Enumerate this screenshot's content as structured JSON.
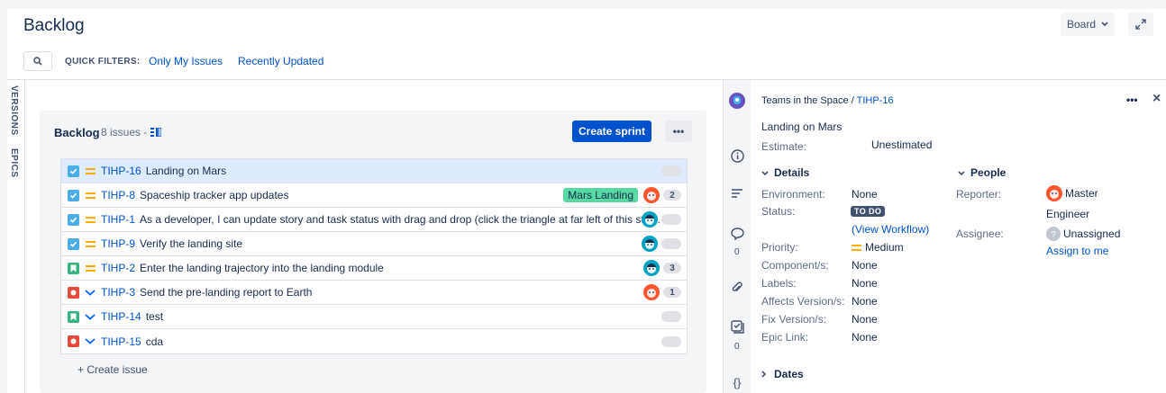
{
  "header": {
    "title": "Backlog",
    "board_label": "Board",
    "quick_filters_label": "QUICK FILTERS:",
    "quick_filters": [
      "Only My Issues",
      "Recently Updated"
    ]
  },
  "side_tabs": [
    "VERSIONS",
    "EPICS"
  ],
  "backlog": {
    "title": "Backlog",
    "count": "8 issues -",
    "create_sprint": "Create sprint",
    "more": "•••",
    "create_issue": "+ Create issue",
    "issues": [
      {
        "type": "task",
        "priority": "medium",
        "key": "TIHP-16",
        "summary": "Landing on Mars",
        "epic": "",
        "avatar": "",
        "count": "",
        "selected": true
      },
      {
        "type": "task",
        "priority": "medium",
        "key": "TIHP-8",
        "summary": "Spaceship tracker app updates",
        "epic": "Mars Landing",
        "avatar": "orange",
        "count": "2",
        "selected": false
      },
      {
        "type": "task",
        "priority": "medium",
        "key": "TIHP-1",
        "summary": "As a developer, I can update story and task status with drag and drop (click the triangle at far left of this sto…",
        "epic": "",
        "avatar": "teal",
        "count": "",
        "selected": false
      },
      {
        "type": "task",
        "priority": "medium",
        "key": "TIHP-9",
        "summary": "Verify the landing site",
        "epic": "",
        "avatar": "teal",
        "count": "",
        "selected": false
      },
      {
        "type": "story",
        "priority": "medium",
        "key": "TIHP-2",
        "summary": "Enter the landing trajectory into the landing module",
        "epic": "",
        "avatar": "teal",
        "count": "3",
        "selected": false
      },
      {
        "type": "bug",
        "priority": "low",
        "key": "TIHP-3",
        "summary": "Send the pre-landing report to Earth",
        "epic": "",
        "avatar": "orange",
        "count": "1",
        "selected": false
      },
      {
        "type": "story",
        "priority": "low",
        "key": "TIHP-14",
        "summary": "test",
        "epic": "",
        "avatar": "",
        "count": "",
        "selected": false
      },
      {
        "type": "bug",
        "priority": "low",
        "key": "TIHP-15",
        "summary": "cda",
        "epic": "",
        "avatar": "",
        "count": "",
        "selected": false
      }
    ]
  },
  "detail": {
    "project": "Teams in the Space",
    "sep": "/",
    "key": "TIHP-16",
    "more": "•••",
    "close": "×",
    "summary": "Landing on Mars",
    "estimate_label": "Estimate:",
    "estimate_value": "Unestimated",
    "details_heading": "Details",
    "people_heading": "People",
    "dates_heading": "Dates",
    "fields": {
      "environment_label": "Environment:",
      "environment_value": "None",
      "status_label": "Status:",
      "status_value": "TO DO",
      "view_workflow": "(View Workflow)",
      "priority_label": "Priority:",
      "priority_value": "Medium",
      "components_label": "Component/s:",
      "components_value": "None",
      "labels_label": "Labels:",
      "labels_value": "None",
      "affects_label": "Affects Version/s:",
      "affects_value": "None",
      "fix_label": "Fix Version/s:",
      "fix_value": "None",
      "epic_label": "Epic Link:",
      "epic_value": "None"
    },
    "people": {
      "reporter_label": "Reporter:",
      "reporter_line1": "Master",
      "reporter_line2": "Engineer",
      "assignee_label": "Assignee:",
      "assignee_value": "Unassigned",
      "assign_to_me": "Assign to me"
    },
    "rail_counts": [
      "0",
      "0"
    ]
  },
  "colors": {
    "primary": "#0052cc",
    "task": "#4bade8",
    "story": "#36b37e",
    "bug": "#e5493a",
    "medium_priority": "#ffab00",
    "low_priority": "#0065ff",
    "epic": "#57d9a3",
    "todo": "#42526e"
  }
}
